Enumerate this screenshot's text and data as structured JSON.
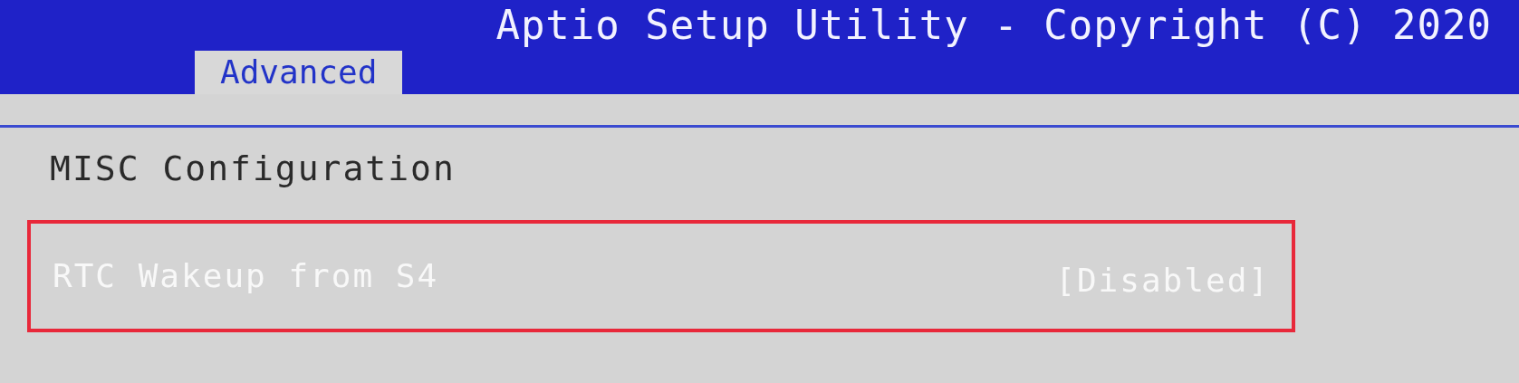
{
  "header": {
    "title": "Aptio Setup Utility - Copyright (C) 2020"
  },
  "tabs": [
    {
      "label": "Advanced",
      "selected": true
    }
  ],
  "section": {
    "title": "MISC Configuration"
  },
  "settings": [
    {
      "label": "RTC Wakeup from S4",
      "value": "[Disabled]",
      "selected": true,
      "annotated": true
    }
  ]
}
